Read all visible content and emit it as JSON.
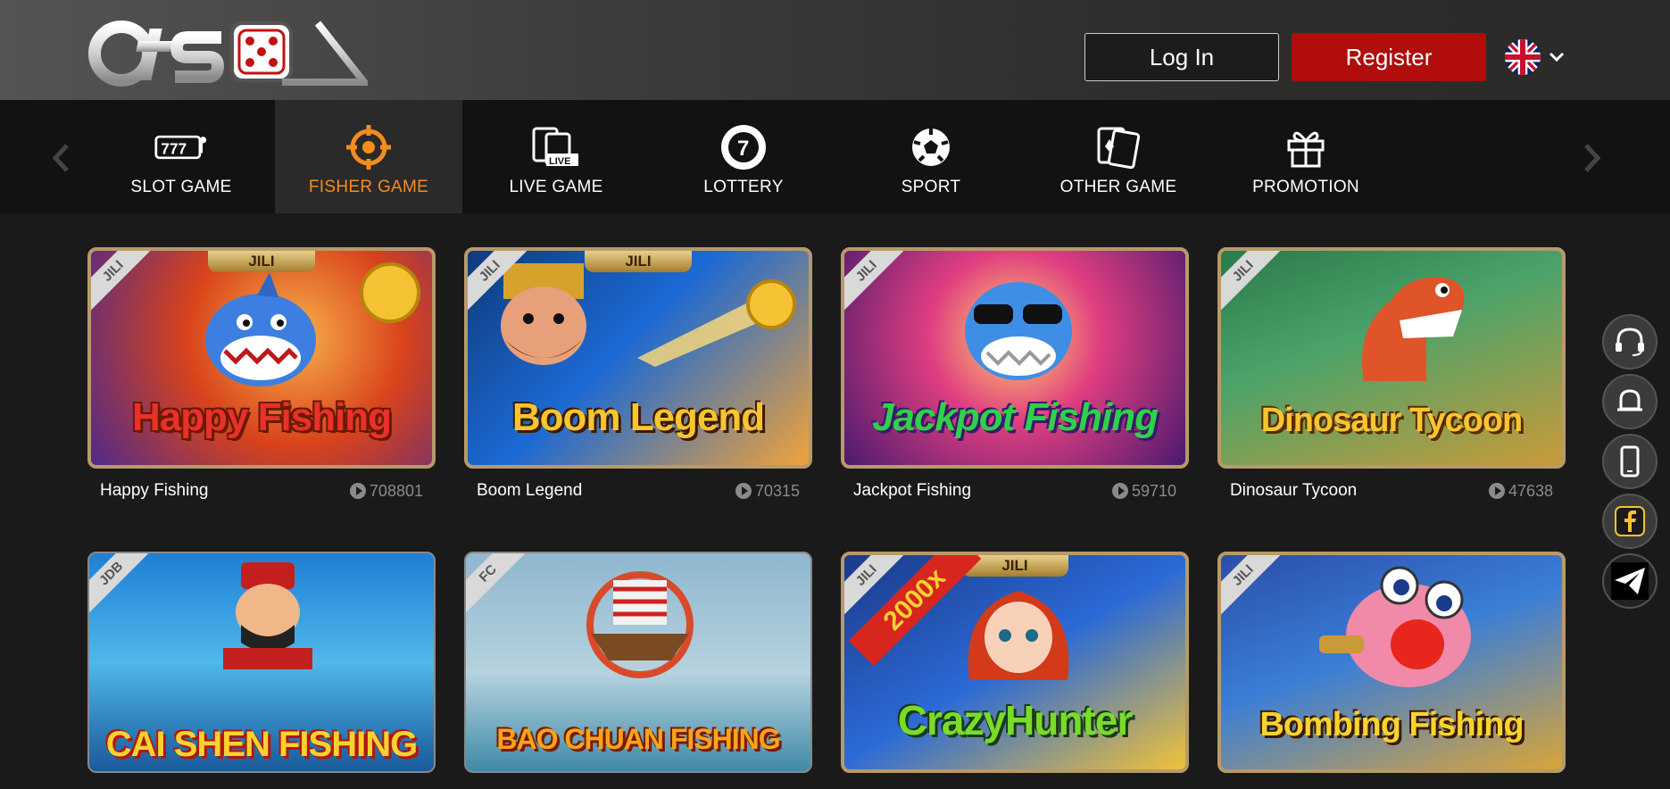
{
  "brand": {
    "logo_text": "OTSO"
  },
  "header": {
    "login_label": "Log In",
    "register_label": "Register",
    "language_icon": "uk-flag-icon"
  },
  "nav": {
    "items": [
      {
        "label": "SLOT GAME",
        "icon": "slot-machine-icon"
      },
      {
        "label": "FISHER GAME",
        "icon": "crosshair-icon",
        "active": true
      },
      {
        "label": "LIVE GAME",
        "icon": "live-cards-icon"
      },
      {
        "label": "LOTTERY",
        "icon": "lottery-ball-icon"
      },
      {
        "label": "SPORT",
        "icon": "soccer-ball-icon"
      },
      {
        "label": "OTHER GAME",
        "icon": "cards-icon"
      },
      {
        "label": "PROMOTION",
        "icon": "gift-icon"
      }
    ]
  },
  "games": [
    {
      "name": "Happy Fishing",
      "plays": "708801",
      "provider": "JILI",
      "banner": "Happy Fishing",
      "top_badge": "JILI"
    },
    {
      "name": "Boom Legend",
      "plays": "70315",
      "provider": "JILI",
      "banner": "Boom Legend",
      "top_badge": "JILI"
    },
    {
      "name": "Jackpot Fishing",
      "plays": "59710",
      "provider": "JILI",
      "banner": "Jackpot Fishing",
      "top_badge": ""
    },
    {
      "name": "Dinosaur Tycoon",
      "plays": "47638",
      "provider": "JILI",
      "banner": "Dinosaur Tycoon",
      "top_badge": ""
    },
    {
      "name": "",
      "plays": "",
      "provider": "JDB",
      "banner": "CAI SHEN FISHING",
      "top_badge": ""
    },
    {
      "name": "",
      "plays": "",
      "provider": "FC",
      "banner": "BAO CHUAN FISHING",
      "top_badge": ""
    },
    {
      "name": "",
      "plays": "",
      "provider": "JILI",
      "banner": "CrazyHunter",
      "top_badge": "JILI",
      "extra": "2000x"
    },
    {
      "name": "",
      "plays": "",
      "provider": "JILI",
      "banner": "Bombing Fishing",
      "top_badge": ""
    }
  ],
  "side_buttons": [
    "headset-icon",
    "bell-icon",
    "mobile-icon",
    "facebook-icon",
    "telegram-icon"
  ],
  "colors": {
    "accent_orange": "#f58c1e",
    "register_red": "#b00d0c",
    "bg": "#1a1a1a"
  }
}
